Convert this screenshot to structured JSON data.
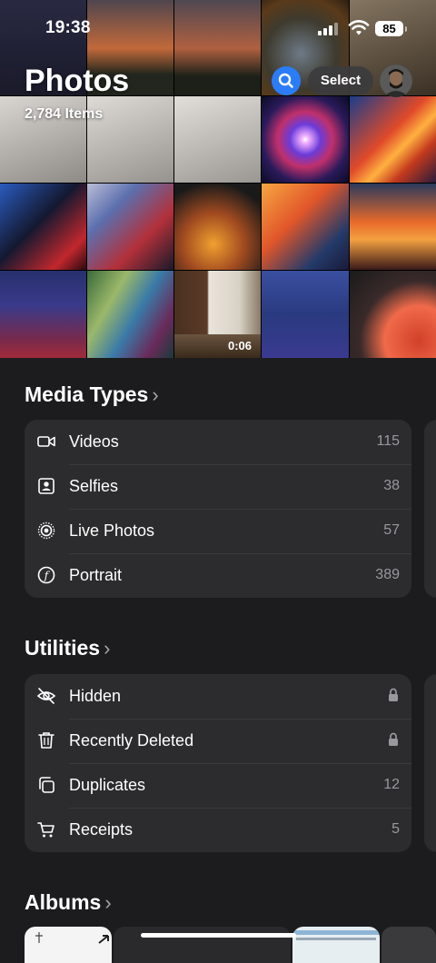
{
  "status_bar": {
    "time": "19:38",
    "battery": "85"
  },
  "header": {
    "title": "Photos",
    "item_count": "2,784 Items",
    "select_label": "Select"
  },
  "grid": {
    "video_duration": "0:06"
  },
  "media_types": {
    "heading": "Media Types",
    "items": [
      {
        "label": "Videos",
        "count": "115",
        "icon": "video-icon"
      },
      {
        "label": "Selfies",
        "count": "38",
        "icon": "selfie-icon"
      },
      {
        "label": "Live Photos",
        "count": "57",
        "icon": "live-photo-icon"
      },
      {
        "label": "Portrait",
        "count": "389",
        "icon": "portrait-icon"
      }
    ]
  },
  "utilities": {
    "heading": "Utilities",
    "items": [
      {
        "label": "Hidden",
        "count": "",
        "icon": "eye-slash-icon",
        "locked": true
      },
      {
        "label": "Recently Deleted",
        "count": "",
        "icon": "trash-icon",
        "locked": true
      },
      {
        "label": "Duplicates",
        "count": "12",
        "icon": "duplicates-icon"
      },
      {
        "label": "Receipts",
        "count": "5",
        "icon": "cart-icon"
      }
    ]
  },
  "albums": {
    "heading": "Albums"
  },
  "colors": {
    "accent": "#2b7cf7",
    "card": "#2c2c2e",
    "background": "#1c1c1e",
    "secondary_text": "#98989d"
  }
}
